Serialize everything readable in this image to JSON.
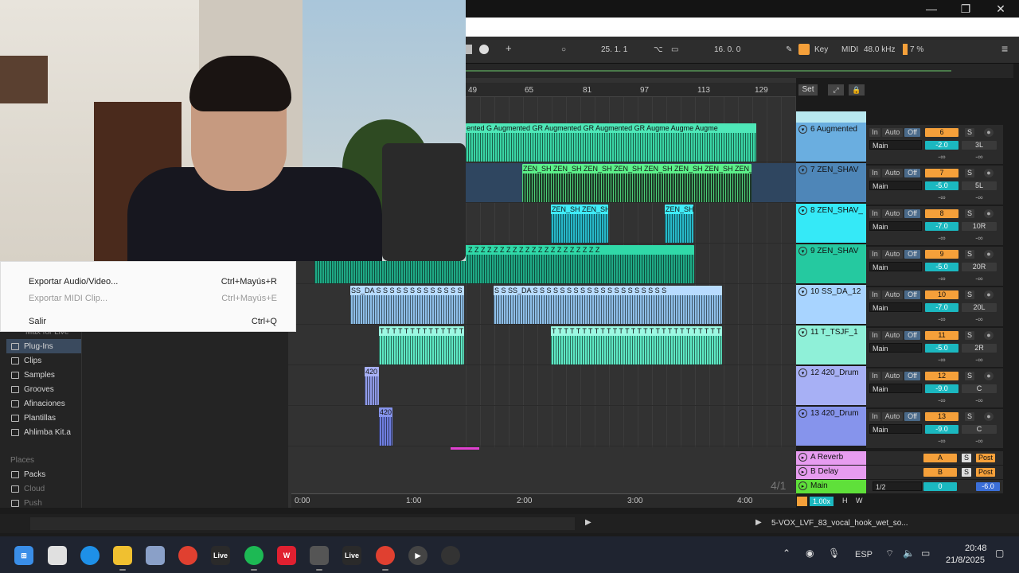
{
  "window": {
    "minimize_icon": "—",
    "restore_icon": "❐",
    "close_icon": "✕"
  },
  "transport": {
    "position": "25.   1.   1",
    "loop_length": "16.   0.   0",
    "key_label": "Key",
    "midi_label": "MIDI",
    "sample_rate": "48.0 kHz",
    "cpu": "7 %"
  },
  "ruler": {
    "bars": [
      "49",
      "65",
      "81",
      "97",
      "113",
      "129"
    ],
    "set_label": "Set"
  },
  "timeline": {
    "times": [
      "0:00",
      "1:00",
      "2:00",
      "3:00",
      "4:00"
    ],
    "signature": "4/1"
  },
  "clips": {
    "augmented_heads": "ented G Augmented GR Augmented GR Augmented GR Augme Augme Augme",
    "zen_heads": "ZEN_SH ZEN_SH ZEN_SH ZEN_SH ZEN_SH ZEN_SH ZEN_SH ZEN_SH",
    "zen2_a": "ZEN_SH ZEN_SH",
    "zen2_b": "ZEN_SH",
    "z_heads": "Z Z Z Z Z Z Z Z Z Z Z Z Z Z Z Z Z Z Z Z Z Z Z Z Z Z Z Z Z Z Z Z Z Z Z Z Z Z Z Z Z Z Z Z Z",
    "ss_a": "SS_DA S S S S S S S S S S S S S S",
    "ss_b": "S S SS_DA S S S S S S S S S S S S S S S S S S S S",
    "t_a": "T T T T T T T T T T T T T T T",
    "t_b": "T T T T T T T T T T T T T T T T T T T T T T T T T T T T T T",
    "drum1": "420",
    "drum2": "420"
  },
  "tracks": [
    {
      "name": "6 Augmented",
      "num": "6",
      "input": "Main",
      "vol": "-2.0",
      "pan": "3L",
      "color": "#6aaee0"
    },
    {
      "name": "7 ZEN_SHAV",
      "num": "7",
      "input": "Main",
      "vol": "-5.0",
      "pan": "5L",
      "color": "#4e86b8"
    },
    {
      "name": "8 ZEN_SHAV_",
      "num": "8",
      "input": "Main",
      "vol": "-7.0",
      "pan": "10R",
      "color": "#35e9f7"
    },
    {
      "name": "9 ZEN_SHAV",
      "num": "9",
      "input": "Main",
      "vol": "-5.0",
      "pan": "20R",
      "color": "#25c9a0"
    },
    {
      "name": "10 SS_DA_12",
      "num": "10",
      "input": "Main",
      "vol": "-7.0",
      "pan": "20L",
      "color": "#a8d4ff"
    },
    {
      "name": "11 T_TSJF_1",
      "num": "11",
      "input": "Main",
      "vol": "-5.0",
      "pan": "2R",
      "color": "#8ff0d8"
    },
    {
      "name": "12 420_Drum",
      "num": "12",
      "input": "Main",
      "vol": "-9.0",
      "pan": "C",
      "color": "#a7b0f5"
    },
    {
      "name": "13 420_Drum",
      "num": "13",
      "input": "Main",
      "vol": "-9.0",
      "pan": "C",
      "color": "#8694ec"
    }
  ],
  "mixer_labels": {
    "in": "In",
    "auto": "Auto",
    "off": "Off",
    "solo": "S",
    "post": "Post",
    "dash": "-∞",
    "dash2": "-∞"
  },
  "returns": [
    {
      "name": "A Reverb",
      "letter": "A"
    },
    {
      "name": "B Delay",
      "letter": "B"
    }
  ],
  "main_track": {
    "name": "Main",
    "ratio": "1/2",
    "vol": "0",
    "pan": "-6.0"
  },
  "zoom": {
    "value": "1.00x",
    "h": "H",
    "w": "W"
  },
  "menu": {
    "items": [
      {
        "label": "Exportar Audio/Video...",
        "shortcut": "Ctrl+Mayús+R"
      },
      {
        "label": "Exportar MIDI Clip...",
        "shortcut": "Ctrl+Mayús+E"
      },
      {
        "label": "Salir",
        "shortcut": "Ctrl+Q"
      }
    ]
  },
  "browser": {
    "partial": "Max for Live",
    "items": [
      "Plug-Ins",
      "Clips",
      "Samples",
      "Grooves",
      "Afinaciones",
      "Plantillas",
      "Ahlimba Kit.a"
    ],
    "places_label": "Places",
    "places": [
      "Packs",
      "Cloud",
      "Push"
    ]
  },
  "statusbar": {
    "file": "5-VOX_LVF_83_vocal_hook_wet_so..."
  },
  "taskbar": {
    "lang": "ESP",
    "time": "20:48",
    "date": "21/8/2025",
    "live1": "Live",
    "live2": "Live"
  }
}
